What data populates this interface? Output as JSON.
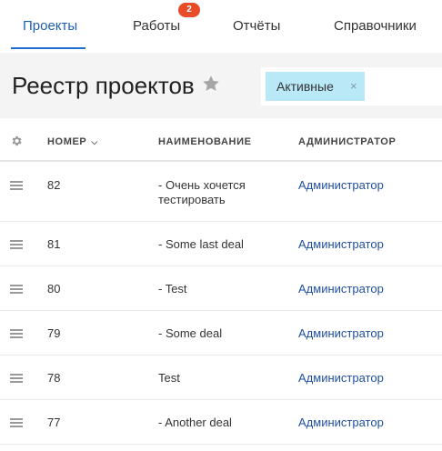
{
  "nav": {
    "tabs": [
      {
        "label": "Проекты",
        "active": true
      },
      {
        "label": "Работы",
        "badge": "2"
      },
      {
        "label": "Отчёты"
      },
      {
        "label": "Справочники"
      }
    ]
  },
  "header": {
    "title": "Реестр проектов",
    "filter_chip": {
      "label": "Активные",
      "close": "×"
    }
  },
  "table": {
    "columns": {
      "number": "НОМЕР",
      "name": "НАИМЕНОВАНИЕ",
      "admin": "АДМИНИСТРАТОР"
    },
    "rows": [
      {
        "number": "82",
        "name": "- Очень хочется тестировать",
        "admin": "Администратор"
      },
      {
        "number": "81",
        "name": "- Some last deal",
        "admin": "Администратор"
      },
      {
        "number": "80",
        "name": "- Test",
        "admin": "Администратор"
      },
      {
        "number": "79",
        "name": "- Some deal",
        "admin": "Администратор"
      },
      {
        "number": "78",
        "name": "Test",
        "admin": "Администратор"
      },
      {
        "number": "77",
        "name": "- Another deal",
        "admin": "Администратор"
      }
    ]
  },
  "colors": {
    "accent": "#1f6fd1",
    "link": "#1f4f9f",
    "badge": "#e84b27",
    "chip": "#b9e8f7"
  }
}
